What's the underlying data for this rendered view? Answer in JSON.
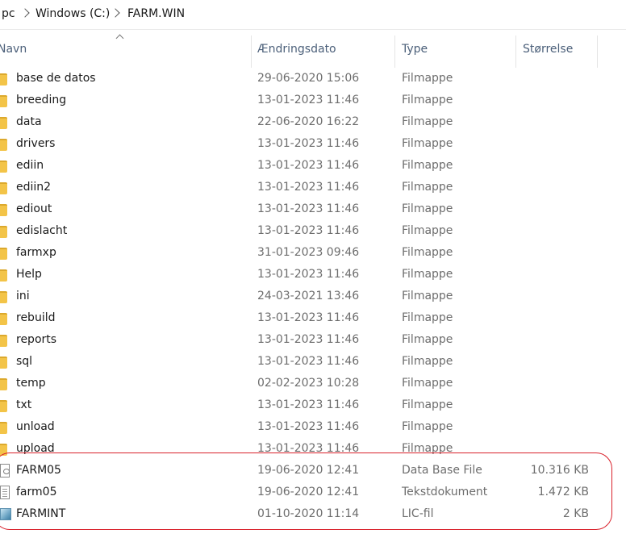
{
  "breadcrumb": {
    "items": [
      "pc",
      "Windows (C:)",
      "FARM.WIN"
    ]
  },
  "columns": {
    "name": "Navn",
    "date": "Ændringsdato",
    "type": "Type",
    "size": "Størrelse"
  },
  "rows": [
    {
      "name": "base de datos",
      "date": "29-06-2020 15:06",
      "type": "Filmappe",
      "size": "",
      "icon": "folder-icon"
    },
    {
      "name": "breeding",
      "date": "13-01-2023 11:46",
      "type": "Filmappe",
      "size": "",
      "icon": "folder-icon"
    },
    {
      "name": "data",
      "date": "22-06-2020 16:22",
      "type": "Filmappe",
      "size": "",
      "icon": "folder-icon"
    },
    {
      "name": "drivers",
      "date": "13-01-2023 11:46",
      "type": "Filmappe",
      "size": "",
      "icon": "folder-icon"
    },
    {
      "name": "ediin",
      "date": "13-01-2023 11:46",
      "type": "Filmappe",
      "size": "",
      "icon": "folder-icon"
    },
    {
      "name": "ediin2",
      "date": "13-01-2023 11:46",
      "type": "Filmappe",
      "size": "",
      "icon": "folder-icon"
    },
    {
      "name": "ediout",
      "date": "13-01-2023 11:46",
      "type": "Filmappe",
      "size": "",
      "icon": "folder-icon"
    },
    {
      "name": "edislacht",
      "date": "13-01-2023 11:46",
      "type": "Filmappe",
      "size": "",
      "icon": "folder-icon"
    },
    {
      "name": "farmxp",
      "date": "31-01-2023 09:46",
      "type": "Filmappe",
      "size": "",
      "icon": "folder-icon"
    },
    {
      "name": "Help",
      "date": "13-01-2023 11:46",
      "type": "Filmappe",
      "size": "",
      "icon": "folder-icon"
    },
    {
      "name": "ini",
      "date": "24-03-2021 13:46",
      "type": "Filmappe",
      "size": "",
      "icon": "folder-icon"
    },
    {
      "name": "rebuild",
      "date": "13-01-2023 11:46",
      "type": "Filmappe",
      "size": "",
      "icon": "folder-icon"
    },
    {
      "name": "reports",
      "date": "13-01-2023 11:46",
      "type": "Filmappe",
      "size": "",
      "icon": "folder-icon"
    },
    {
      "name": "sql",
      "date": "13-01-2023 11:46",
      "type": "Filmappe",
      "size": "",
      "icon": "folder-icon"
    },
    {
      "name": "temp",
      "date": "02-02-2023 10:28",
      "type": "Filmappe",
      "size": "",
      "icon": "folder-icon"
    },
    {
      "name": "txt",
      "date": "13-01-2023 11:46",
      "type": "Filmappe",
      "size": "",
      "icon": "folder-icon"
    },
    {
      "name": "unload",
      "date": "13-01-2023 11:46",
      "type": "Filmappe",
      "size": "",
      "icon": "folder-icon"
    },
    {
      "name": "upload",
      "date": "13-01-2023 11:46",
      "type": "Filmappe",
      "size": "",
      "icon": "folder-icon"
    },
    {
      "name": "FARM05",
      "date": "19-06-2020 12:41",
      "type": "Data Base File",
      "size": "10.316 KB",
      "icon": "database-file-icon"
    },
    {
      "name": "farm05",
      "date": "19-06-2020 12:41",
      "type": "Tekstdokument",
      "size": "1.472 KB",
      "icon": "text-document-icon"
    },
    {
      "name": "FARMINT",
      "date": "01-10-2020 11:14",
      "type": "LIC-fil",
      "size": "2 KB",
      "icon": "license-file-icon"
    }
  ],
  "colors": {
    "folder": "#f3c448",
    "highlight": "#d9202a",
    "header_text": "#4c607a",
    "meta_text": "#6d6d6d"
  }
}
